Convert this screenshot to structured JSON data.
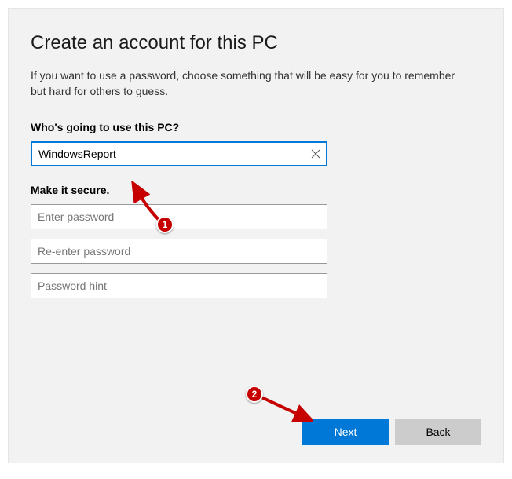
{
  "title": "Create an account for this PC",
  "subtitle": "If you want to use a password, choose something that will be easy for you to remember but hard for others to guess.",
  "username_section_label": "Who's going to use this PC?",
  "username_value": "WindowsReport",
  "secure_section_label": "Make it secure.",
  "password_placeholder": "Enter password",
  "confirm_placeholder": "Re-enter password",
  "hint_placeholder": "Password hint",
  "next_label": "Next",
  "back_label": "Back",
  "annotations": {
    "one": "1",
    "two": "2"
  }
}
